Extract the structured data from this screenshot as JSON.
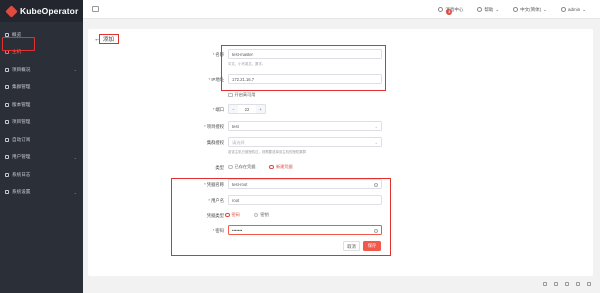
{
  "app": {
    "name": "KubeOperator"
  },
  "sidebar": {
    "items": [
      {
        "label": "概览"
      },
      {
        "label": "主机",
        "active": true
      },
      {
        "label": "项目概况"
      },
      {
        "label": "集群管理"
      },
      {
        "label": "版本管理"
      },
      {
        "label": "项目管理"
      },
      {
        "label": "自动订阅"
      },
      {
        "label": "用户管理"
      },
      {
        "label": "系统日志"
      },
      {
        "label": "系统设置"
      }
    ]
  },
  "topbar": {
    "messages": "消息中心",
    "messages_badge": "3",
    "help": "帮助",
    "language": "中文(简体)",
    "user": "admin"
  },
  "page": {
    "back_label": "添加"
  },
  "form": {
    "name_label": "名称",
    "name_value": "test-master",
    "name_hint": "中文、小写英文、数字、",
    "ip_label": "IP地址",
    "ip_value": "172.21.16.7",
    "auto_label": "开启高可用",
    "port_label": "端口",
    "port_value": "22",
    "project_label": "项目授权",
    "project_value": "test",
    "cluster_label": "集群授权",
    "cluster_placeholder": "请选择",
    "cluster_hint": "若该主机已被授权过，则需要选择该主机的授权集群",
    "credential_type_label": "类型",
    "credential_existing": "已存在凭据",
    "credential_new": "新建凭据",
    "credential_name_label": "凭据名称",
    "credential_name_value": "test-root",
    "username_label": "用户名",
    "username_value": "root",
    "auth_type_label": "凭据类型",
    "auth_password": "密码",
    "auth_key": "密钥",
    "password_label": "密码",
    "password_value": "•••••••",
    "cancel_button": "取消",
    "save_button": "保存"
  },
  "colors": {
    "accent": "#f05a4a",
    "sidebar_bg": "#2b2f38",
    "highlight": "#e03030"
  }
}
